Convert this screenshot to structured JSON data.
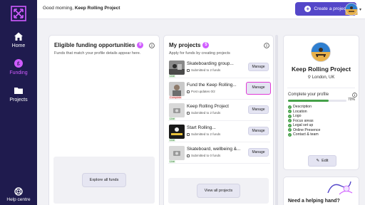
{
  "sidebar": {
    "items": [
      {
        "label": "Home",
        "icon": "home-icon"
      },
      {
        "label": "Funding",
        "icon": "funding-icon",
        "active": true
      },
      {
        "label": "Projects",
        "icon": "folder-icon"
      }
    ],
    "help_label": "Help centre"
  },
  "topbar": {
    "greeting_prefix": "Good morning, ",
    "greeting_name": "Keep Rolling Project",
    "create_label": "Create a project"
  },
  "funding": {
    "title": "Eligible funding opportunities",
    "count": "0",
    "subtitle": "Funds that match your profile details appear here.",
    "explore_label": "Explore all funds"
  },
  "projects": {
    "title": "My projects",
    "count": "5",
    "subtitle": "Apply for funds by creating projects",
    "manage_label": "Manage",
    "view_all_label": "View all projects",
    "items": [
      {
        "name": "Skateboarding group...",
        "status": "Submitted to 2 funds",
        "badge": "Live",
        "thumb": "photo"
      },
      {
        "name": "Fund the Keep Rolling...",
        "status": "Post updates 0/2",
        "badge": "Complete",
        "thumb": "photo"
      },
      {
        "name": "Keep Rolling Project",
        "status": "Submitted to 2 funds",
        "badge": "Live",
        "thumb": "camera"
      },
      {
        "name": "Start Rolling...",
        "status": "Submitted to 2 funds",
        "badge": "Live",
        "thumb": "photo"
      },
      {
        "name": "Skateboard, wellbeing &...",
        "status": "Submitted to 0 funds",
        "badge": "Live",
        "thumb": "camera"
      }
    ]
  },
  "profile": {
    "name": "Keep Rolling Project",
    "location": "London, UK",
    "complete_title": "Complete your profile",
    "percent_label": "70%",
    "percent": 70,
    "checklist": [
      "Description",
      "Location",
      "Logo",
      "Focus areas",
      "Legal set up",
      "Online Presence",
      "Contact & team"
    ],
    "edit_label": "Edit"
  },
  "help_card": {
    "title": "Need a helping hand?"
  },
  "colors": {
    "sidebar": "#1f1b4e",
    "accent": "#5447c9",
    "magenta": "#d05cff",
    "highlight": "#e03ad6",
    "success": "#45a049"
  }
}
